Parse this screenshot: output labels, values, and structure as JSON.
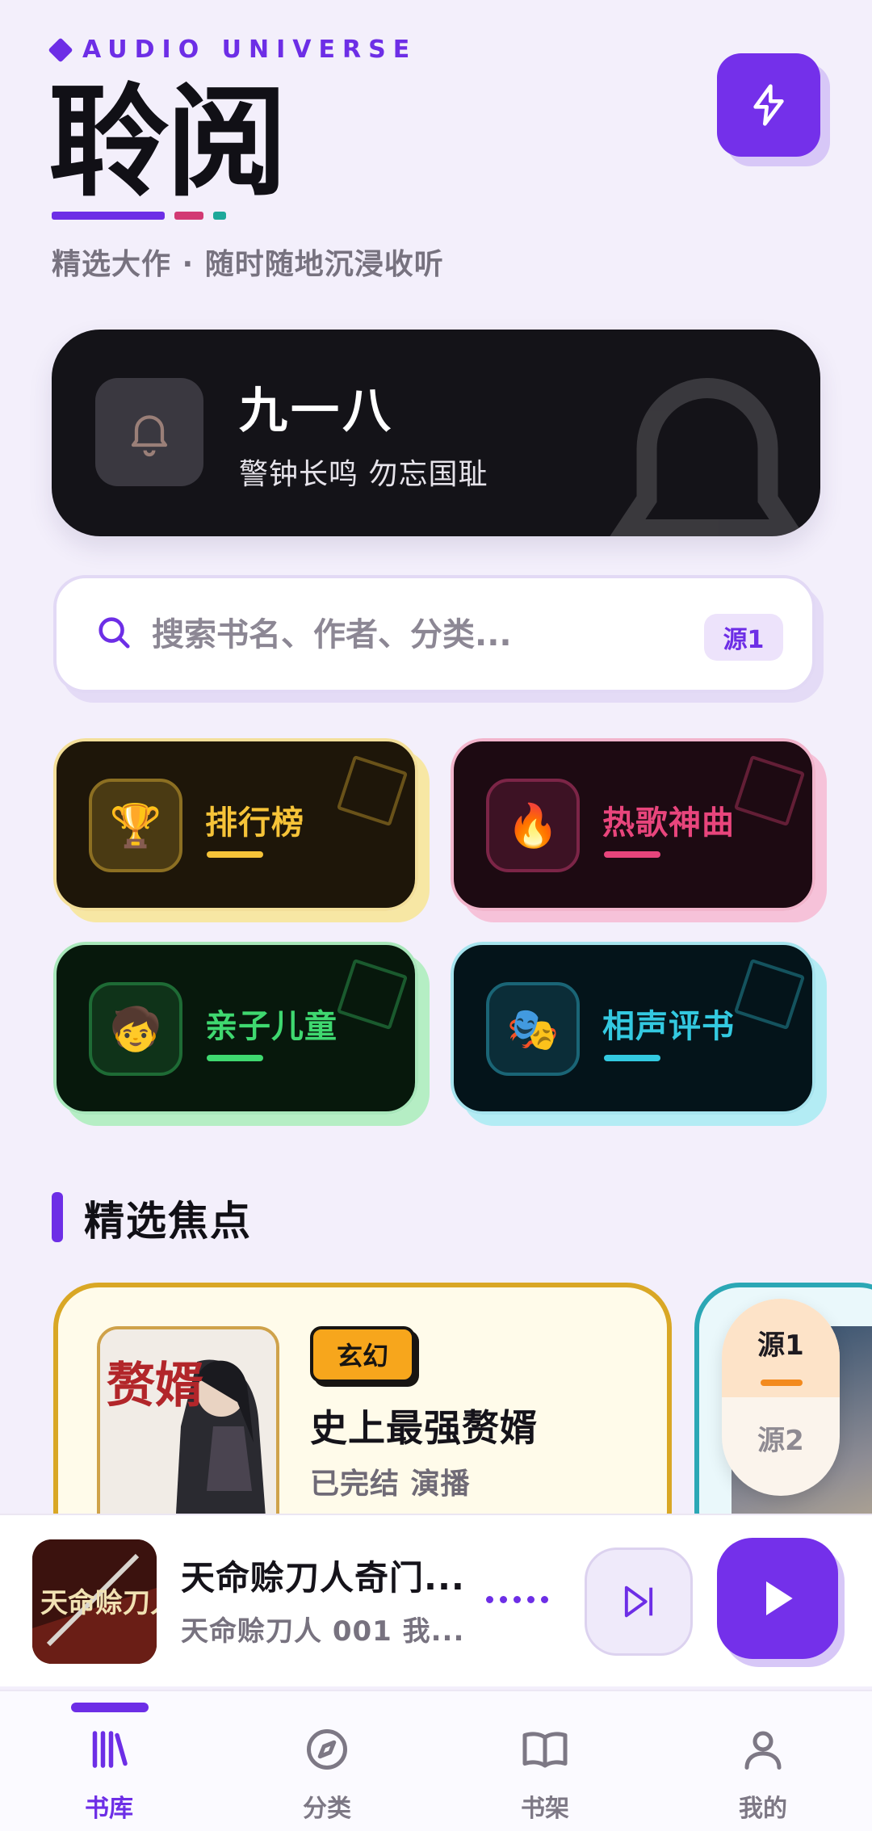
{
  "header": {
    "brand": "AUDIO UNIVERSE",
    "title": "聆阅",
    "subtitle": "精选大作 · 随时随地沉浸收听"
  },
  "banner": {
    "title": "九一八",
    "subtitle": "警钟长鸣 勿忘国耻"
  },
  "search": {
    "placeholder": "搜索书名、作者、分类...",
    "source_badge": "源1"
  },
  "categories": [
    {
      "label": "排行榜",
      "icon": "trophy-icon",
      "emoji": "🏆",
      "color": "#f6c338"
    },
    {
      "label": "热歌神曲",
      "icon": "fire-icon",
      "emoji": "🔥",
      "color": "#e8457c"
    },
    {
      "label": "亲子儿童",
      "icon": "child-icon",
      "emoji": "🧒",
      "color": "#3fd870"
    },
    {
      "label": "相声评书",
      "icon": "theater-masks-icon",
      "emoji": "🎭",
      "color": "#33c9e0"
    }
  ],
  "section": {
    "title": "精选焦点"
  },
  "featured": {
    "genre": "玄幻",
    "title": "史上最强赘婿",
    "meta": "已完结 演播",
    "cover_text": "赘婿"
  },
  "source_switch": {
    "active": "源1",
    "inactive": "源2"
  },
  "player": {
    "title": "天命赊刀人奇门...",
    "subtitle": "天命赊刀人 001 我...",
    "cover_text": "天命赊刀人"
  },
  "nav": [
    {
      "label": "书库",
      "icon": "library-icon",
      "active": true
    },
    {
      "label": "分类",
      "icon": "compass-icon",
      "active": false
    },
    {
      "label": "书架",
      "icon": "book-icon",
      "active": false
    },
    {
      "label": "我的",
      "icon": "user-icon",
      "active": false
    }
  ],
  "colors": {
    "accent": "#6d2ee6",
    "background": "#f3effb"
  }
}
